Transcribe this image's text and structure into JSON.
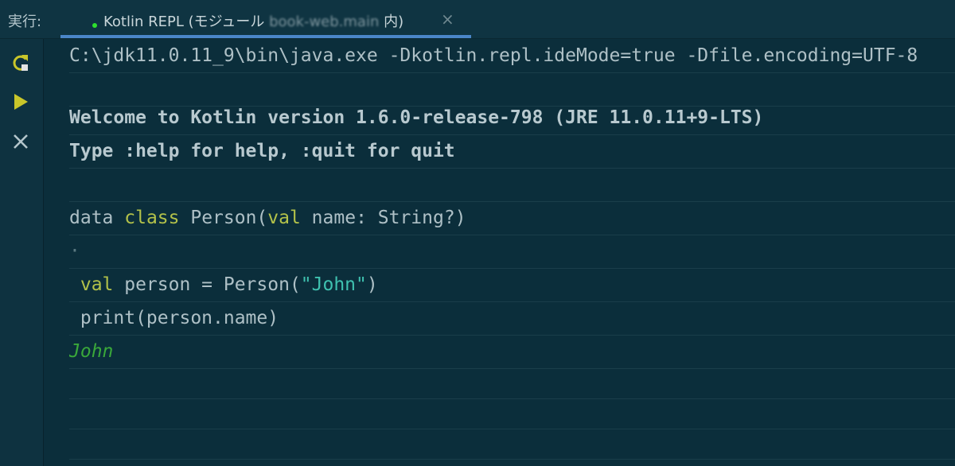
{
  "header": {
    "run_label": "実行:",
    "tab": {
      "title_prefix": "Kotlin REPL (モジュール ",
      "module_name": "book-web.main",
      "title_suffix": " 内)",
      "close": "×"
    }
  },
  "toolbar": {
    "items": [
      "rerun-icon",
      "run-icon",
      "stop-icon"
    ]
  },
  "console": {
    "command": "C:\\jdk11.0.11_9\\bin\\java.exe -Dkotlin.repl.ideMode=true -Dfile.encoding=UTF-8",
    "welcome": "Welcome to Kotlin version 1.6.0-release-798 (JRE 11.0.11+9-LTS)",
    "type_help": "Type :help for help, :quit for quit",
    "code1": {
      "plain1": "data ",
      "kw_class": "class",
      "plain2": " Person(",
      "kw_val": "val",
      "plain3": " name: String?)"
    },
    "blank_dot": "·",
    "code2": {
      "kw_val": " val",
      "plain1": " person = Person(",
      "string": "\"John\"",
      "plain2": ")"
    },
    "code3": " print(person.name)",
    "output": "John"
  },
  "colors": {
    "background": "#0b2e3b",
    "keyword": "#b3c24a",
    "string": "#3fc2b0",
    "output": "#3aa83a",
    "tab_underline": "#4a86c8",
    "run_icon": "#c9c62a"
  }
}
